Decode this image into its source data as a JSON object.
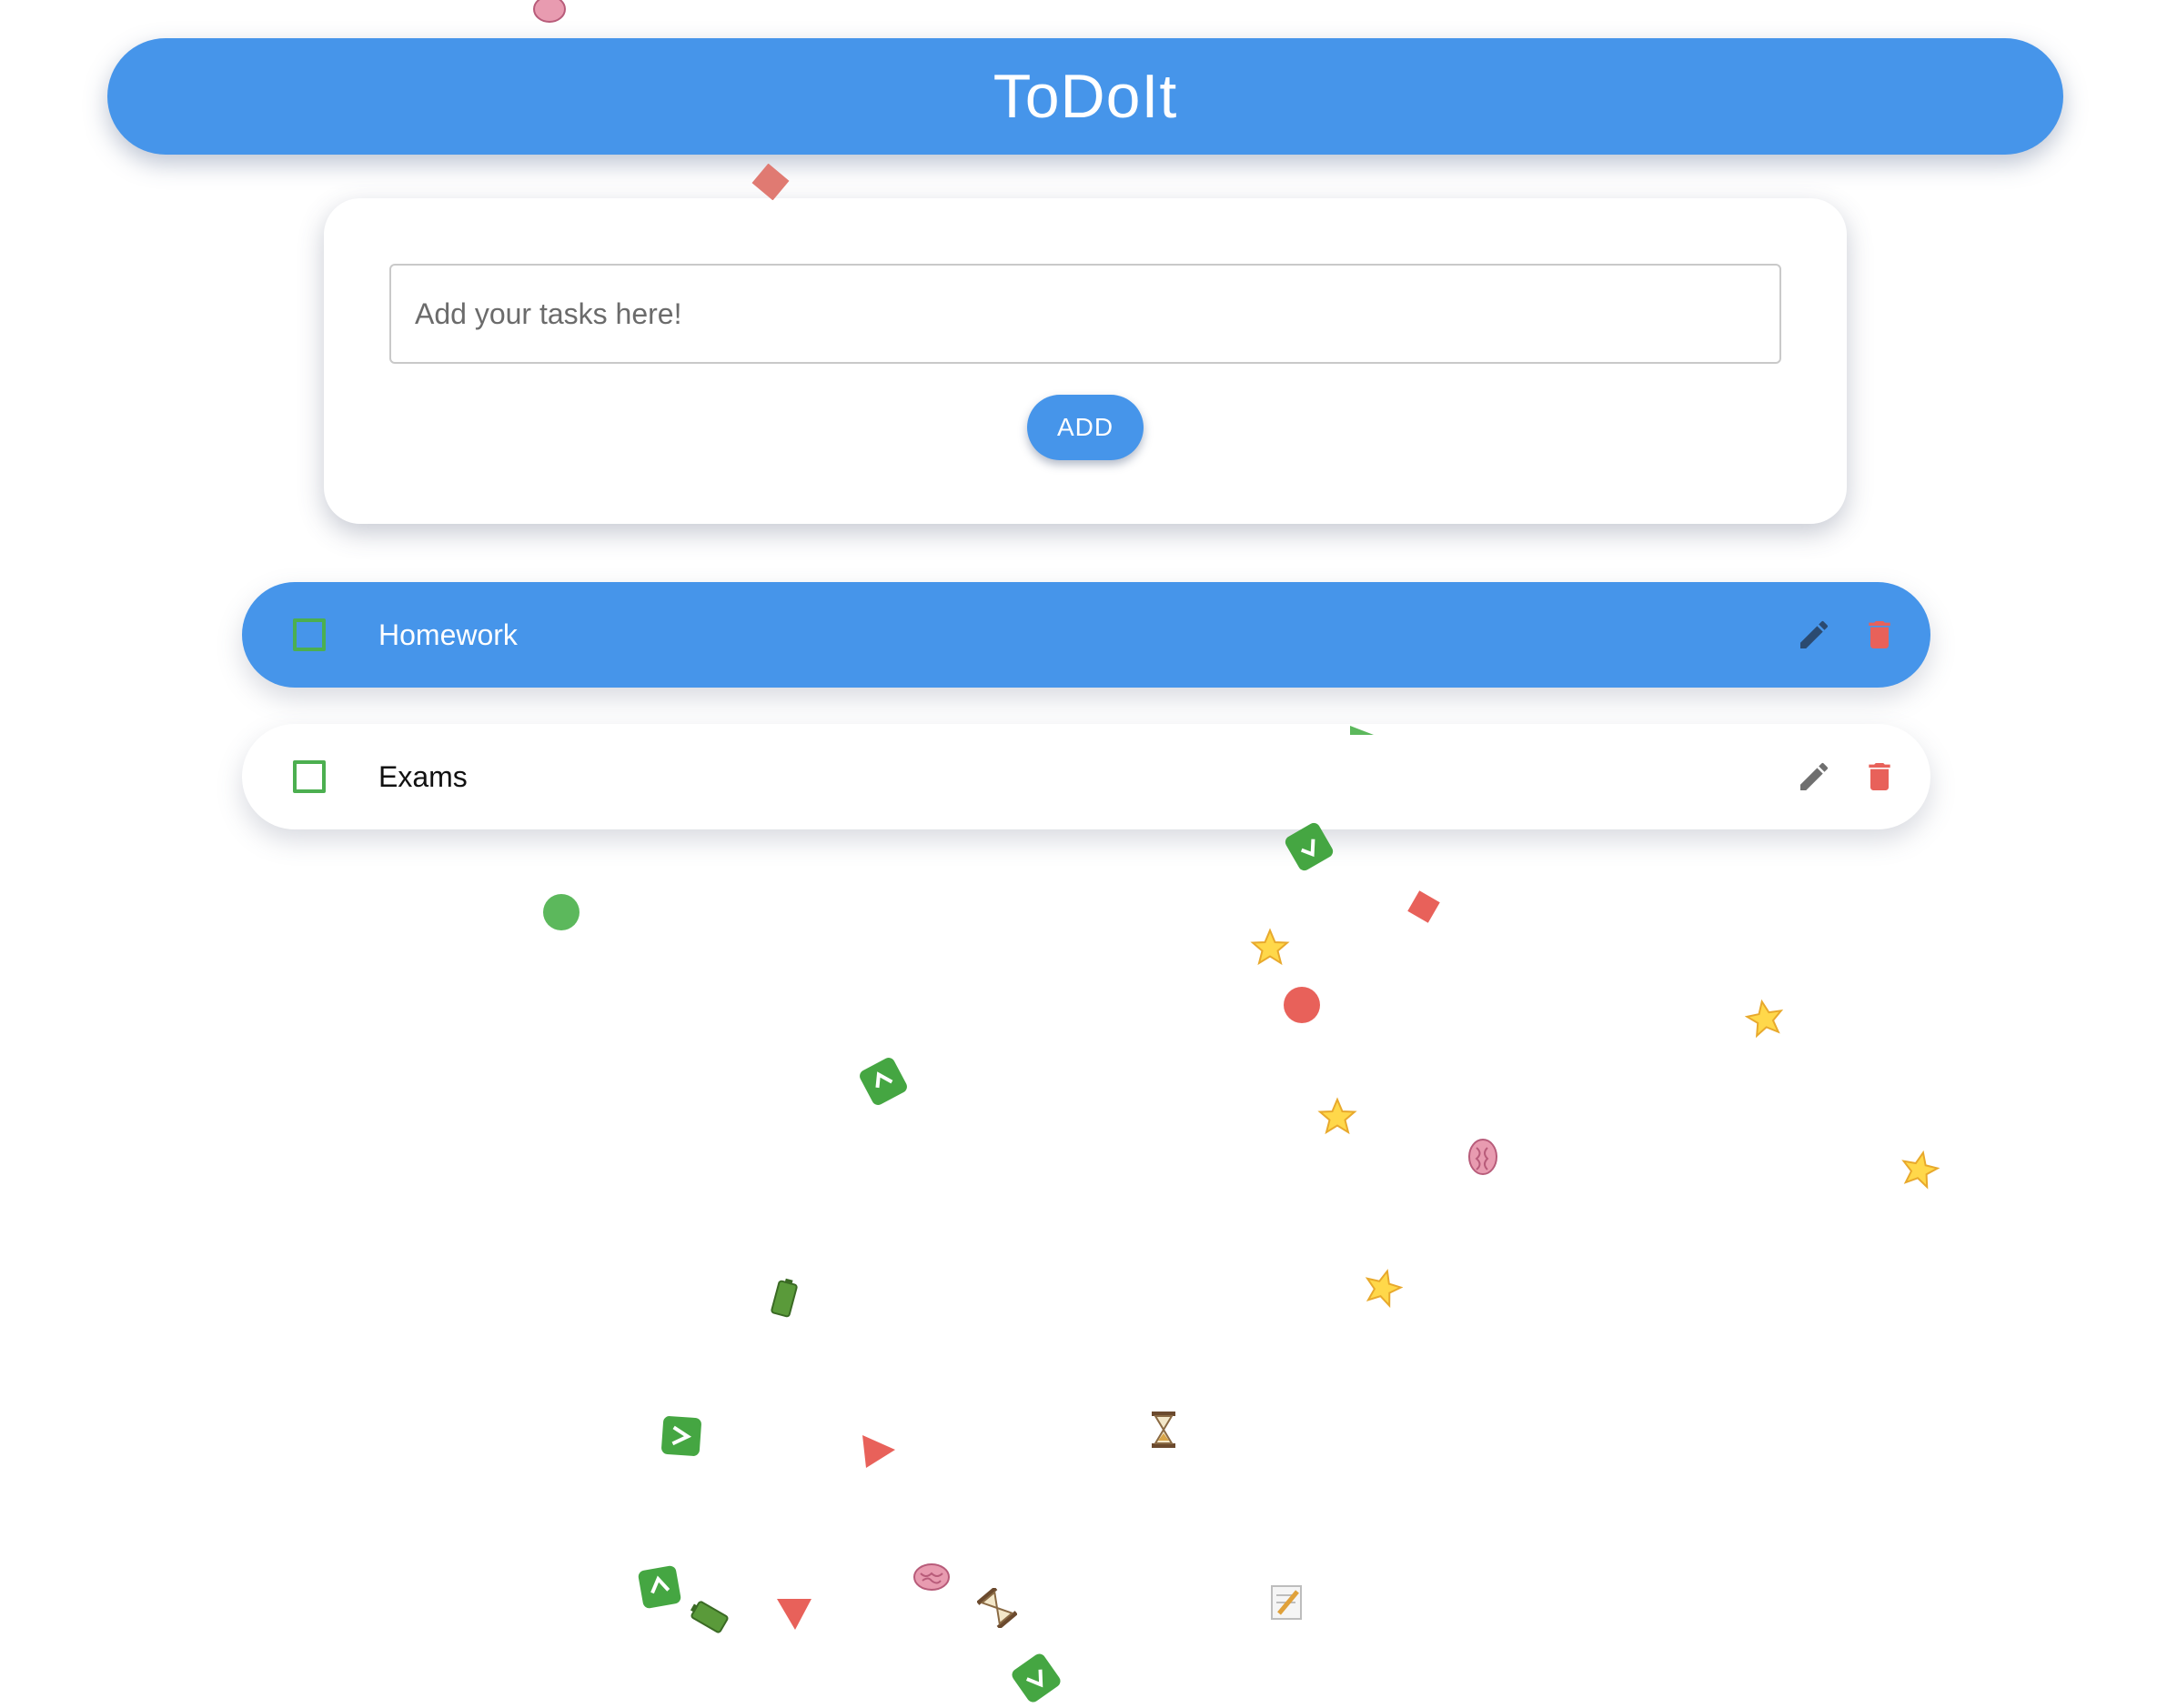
{
  "app": {
    "title": "ToDoIt"
  },
  "task_form": {
    "placeholder": "Add your tasks here!",
    "value": "",
    "add_label": "ADD"
  },
  "tasks": [
    {
      "label": "Homework",
      "checked": false,
      "highlighted": true
    },
    {
      "label": "Exams",
      "checked": false,
      "highlighted": false
    }
  ],
  "colors": {
    "accent_blue": "#4695ea",
    "checkbox_green": "#4caf50",
    "delete_red": "#e8615a",
    "edit_gray_dark": "#2b4a70",
    "edit_gray": "#6f6f6f"
  },
  "icons": {
    "edit": "pencil-icon",
    "delete": "trash-icon"
  },
  "decorations": {
    "confetti_emojis": [
      "star",
      "brain",
      "hourglass",
      "battery",
      "memo",
      "check-square"
    ]
  }
}
